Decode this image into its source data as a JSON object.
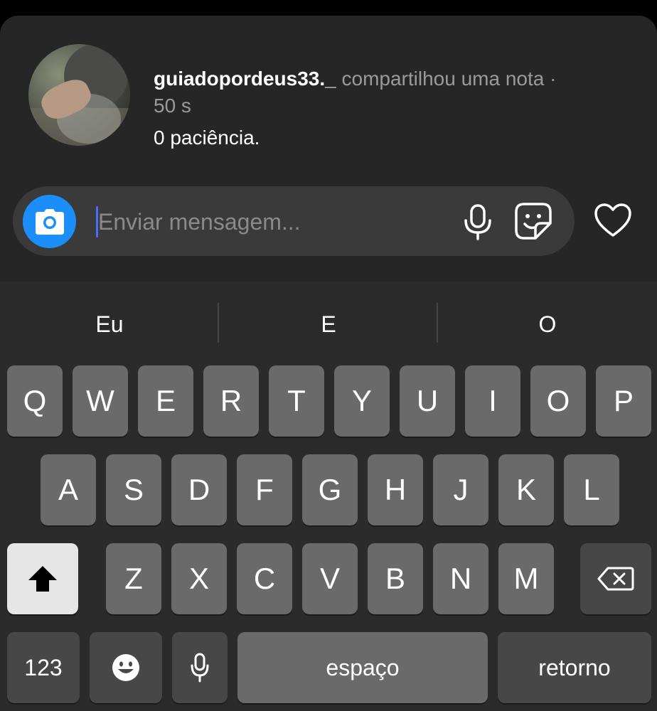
{
  "note": {
    "username": "guiadopordeus33._",
    "action": " compartilhou uma nota · ",
    "time": "50 s",
    "text": "0 paciência."
  },
  "composer": {
    "placeholder": "Enviar mensagem...",
    "icons": [
      "camera-icon",
      "microphone-icon",
      "sticker-icon",
      "heart-icon"
    ]
  },
  "keyboard": {
    "suggestions": [
      "Eu",
      "E",
      "O"
    ],
    "row1": [
      "Q",
      "W",
      "E",
      "R",
      "T",
      "Y",
      "U",
      "I",
      "O",
      "P"
    ],
    "row2": [
      "A",
      "S",
      "D",
      "F",
      "G",
      "H",
      "J",
      "K",
      "L"
    ],
    "row3": [
      "Z",
      "X",
      "C",
      "V",
      "B",
      "N",
      "M"
    ],
    "numbers_label": "123",
    "space_label": "espaço",
    "return_label": "retorno"
  },
  "colors": {
    "accent": "#1c8ef9",
    "sheet_bg": "#262626",
    "key_bg": "#6a6a6a"
  }
}
